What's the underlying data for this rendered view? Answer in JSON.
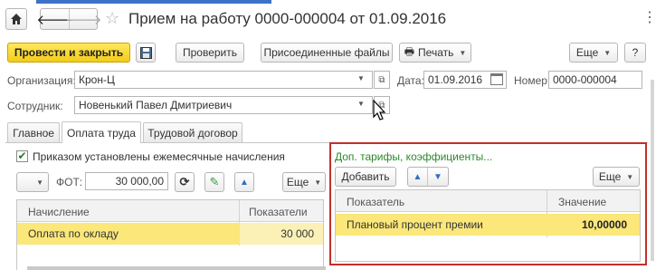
{
  "window": {
    "title": "Прием на работу 0000-000004 от 01.09.2016"
  },
  "toolbar": {
    "post_close_label": "Провести и закрыть",
    "check_label": "Проверить",
    "attached_files_label": "Присоединенные файлы",
    "print_label": "Печать",
    "more_label": "Еще",
    "help_label": "?"
  },
  "form": {
    "org_label": "Организация:",
    "org_value": "Крон-Ц",
    "date_label": "Дата:",
    "date_value": "01.09.2016",
    "number_label": "Номер:",
    "number_value": "0000-000004",
    "employee_label": "Сотрудник:",
    "employee_value": "Новенький Павел Дмитриевич"
  },
  "tabs": [
    {
      "label": "Главное"
    },
    {
      "label": "Оплата труда"
    },
    {
      "label": "Трудовой договор"
    }
  ],
  "pay": {
    "checkbox_label": "Приказом установлены ежемесячные начисления",
    "fot_label": "ФОТ:",
    "fot_value": "30 000,00",
    "more_label": "Еще",
    "columns": [
      "Начисление",
      "Показатели"
    ],
    "rows": [
      {
        "name": "Оплата по окладу",
        "value": "30 000"
      }
    ]
  },
  "extra": {
    "link_label": "Доп. тарифы, коэффициенты...",
    "add_label": "Добавить",
    "more_label": "Еще",
    "columns": [
      "Показатель",
      "Значение"
    ],
    "rows": [
      {
        "name": "Плановый процент премии",
        "value": "10,00000"
      }
    ]
  },
  "colors": {
    "accent_yellow": "#f3cc1a",
    "highlight_row": "#fbe77a",
    "link_green": "#2a8a2a",
    "annotation_red": "#c0312b"
  }
}
